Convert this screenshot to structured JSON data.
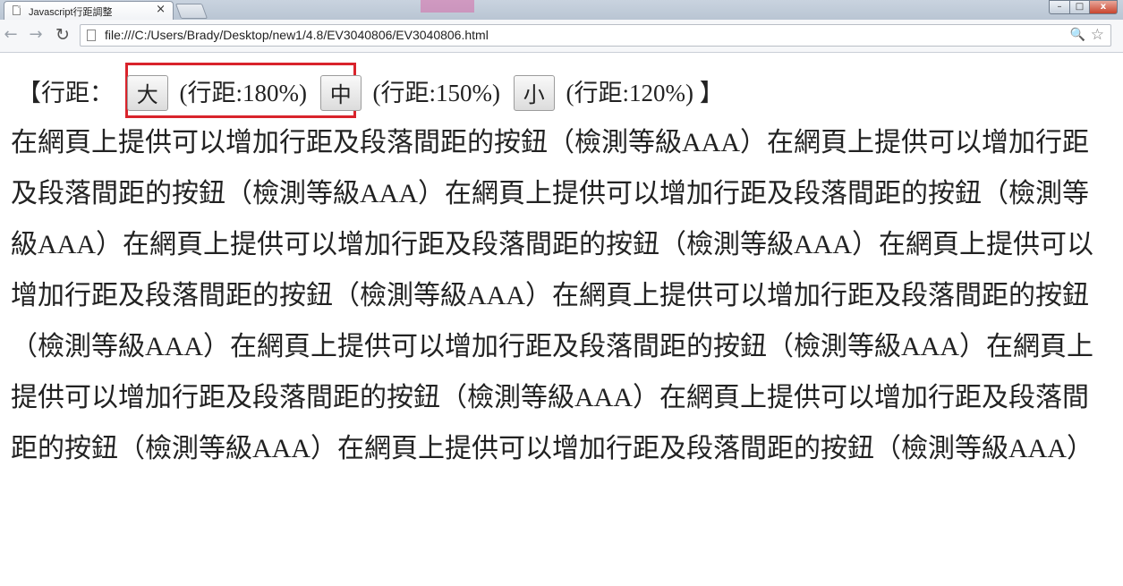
{
  "browser": {
    "tab_title": "Javascript行距調整",
    "tab_close": "×",
    "window_buttons": {
      "minimize": "–",
      "maximize": "□",
      "close": "x"
    },
    "nav": {
      "back": "←",
      "forward": "→",
      "reload": "↻"
    },
    "url": "file:///C:/Users/Brady/Desktop/new1/4.8/EV3040806/EV3040806.html",
    "zoom_icon": "🔍",
    "star_icon": "☆"
  },
  "page": {
    "controls": {
      "open_bracket": "【行距：",
      "buttons": [
        {
          "label": "大",
          "caption": "(行距:180%)"
        },
        {
          "label": "中",
          "caption": "(行距:150%)"
        },
        {
          "label": "小",
          "caption": "(行距:120%)"
        }
      ],
      "close_bracket": "】"
    },
    "paragraph": "在網頁上提供可以增加行距及段落間距的按鈕（檢測等級AAA）在網頁上提供可以增加行距及段落間距的按鈕（檢測等級AAA）在網頁上提供可以增加行距及段落間距的按鈕（檢測等級AAA）在網頁上提供可以增加行距及段落間距的按鈕（檢測等級AAA）在網頁上提供可以增加行距及段落間距的按鈕（檢測等級AAA）在網頁上提供可以增加行距及段落間距的按鈕（檢測等級AAA）在網頁上提供可以增加行距及段落間距的按鈕（檢測等級AAA）在網頁上提供可以增加行距及段落間距的按鈕（檢測等級AAA）在網頁上提供可以增加行距及段落間距的按鈕（檢測等級AAA）在網頁上提供可以增加行距及段落間距的按鈕（檢測等級AAA）",
    "highlight_color": "#d9232b"
  }
}
